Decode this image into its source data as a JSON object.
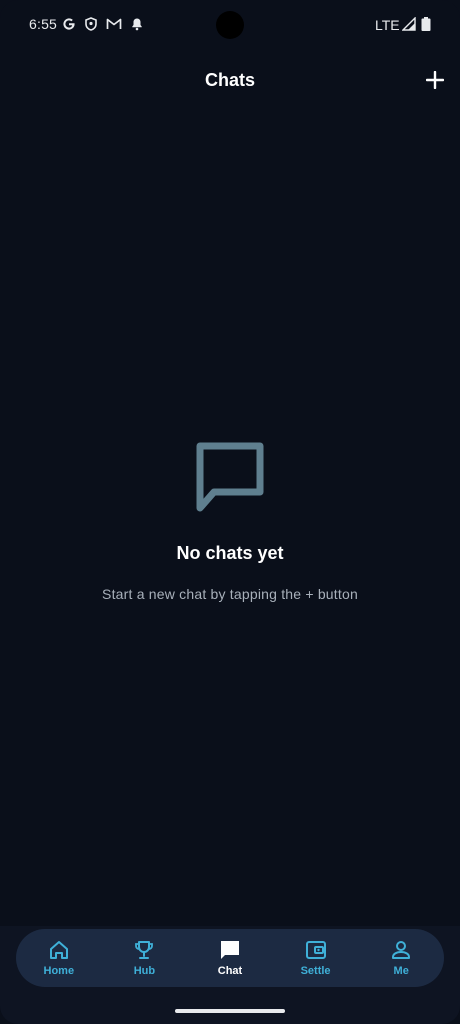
{
  "status_bar": {
    "time": "6:55",
    "network": "LTE",
    "icons": [
      "google-icon",
      "shield-icon",
      "gmail-icon",
      "bell-icon",
      "signal-icon",
      "battery-icon"
    ]
  },
  "header": {
    "title": "Chats",
    "add_icon": "plus-icon"
  },
  "empty_state": {
    "icon": "chat-bubble-icon",
    "title": "No chats yet",
    "subtitle": "Start a new chat by tapping the + button"
  },
  "bottom_nav": {
    "items": [
      {
        "label": "Home",
        "icon": "home-icon",
        "active": false
      },
      {
        "label": "Hub",
        "icon": "trophy-icon",
        "active": false
      },
      {
        "label": "Chat",
        "icon": "chat-icon",
        "active": true
      },
      {
        "label": "Settle",
        "icon": "wallet-icon",
        "active": false
      },
      {
        "label": "Me",
        "icon": "person-icon",
        "active": false
      }
    ]
  },
  "colors": {
    "background": "#0a0f1a",
    "nav_background": "#1c2a42",
    "accent": "#3fb0d8",
    "empty_icon": "#5f7f8f",
    "subtitle": "#a8b0ba"
  }
}
